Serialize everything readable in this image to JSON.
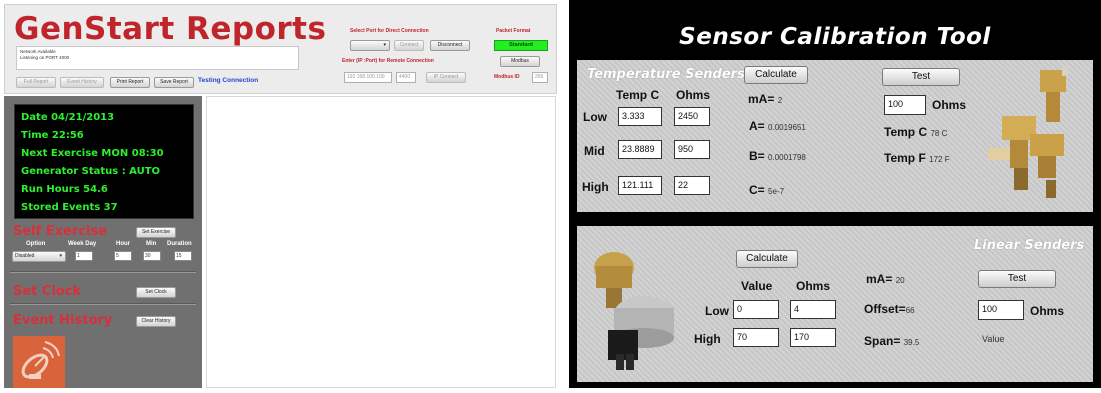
{
  "genstart": {
    "title": "GenStart Reports",
    "log_lines": [
      "Network Available",
      "Listening on PORT 4000"
    ],
    "buttons": {
      "full_report": "Full Report",
      "event_history": "Event History",
      "print_report": "Print Report",
      "save_report": "Save Report",
      "connect": "Connect",
      "disconnect": "Disconnect",
      "ip_connect": "IP Connect",
      "modbus": "Modbus"
    },
    "testing_connection": "Testing Connection",
    "select_port_label": "Select Port for Direct Connection",
    "enter_ip_label": "Enter (IP :Port) for Remote Connection",
    "ip_value": "192.168.100.100",
    "port_value": "4400",
    "packet_format_label": "Packet Format",
    "packet_format_value": "Standard",
    "modbus_id_label": "Modbus ID",
    "modbus_id_value": "255",
    "status": {
      "date": "Date 04/21/2013",
      "time": "Time 22:56",
      "next_exercise": "Next Exercise MON 08:30",
      "generator_status": "Generator Status : AUTO",
      "run_hours": "Run Hours 54.6",
      "stored_events": "Stored Events 37"
    },
    "self_exercise": {
      "title": "Self Exercise",
      "button": "Set Exercise",
      "headers": [
        "Option",
        "Week Day",
        "Hour",
        "Min",
        "Duration"
      ],
      "option_value": "Disabled",
      "week_day_value": "1",
      "hour_value": "5",
      "min_value": "30",
      "duration_value": "15"
    },
    "set_clock": {
      "title": "Set Clock",
      "button": "Set Clock"
    },
    "event_history": {
      "title": "Event History",
      "button": "Clear History"
    },
    "colors": {
      "accent": "#c0252b",
      "status_text": "#2ef02e",
      "packet_standard": "#22ee22",
      "link": "#2244cc"
    }
  },
  "sensor": {
    "title": "Sensor Calibration Tool",
    "temperature": {
      "title": "Temperature Senders",
      "calculate_button": "Calculate",
      "test_button": "Test",
      "col_temp": "Temp C",
      "col_ohms": "Ohms",
      "rows": [
        {
          "label": "Low",
          "temp": "3.333",
          "ohms": "2450"
        },
        {
          "label": "Mid",
          "temp": "23.8889",
          "ohms": "950"
        },
        {
          "label": "High",
          "temp": "121.111",
          "ohms": "22"
        }
      ],
      "ma_label": "mA=",
      "ma_value": "2",
      "a_label": "A=",
      "a_value": "0.0019651",
      "b_label": "B=",
      "b_value": "0.0001798",
      "c_label": "C=",
      "c_value": "5e-7",
      "test_input": "100",
      "test_unit": "Ohms",
      "temp_c_label": "Temp C",
      "temp_c_value": "78 C",
      "temp_f_label": "Temp F",
      "temp_f_value": "172 F"
    },
    "linear": {
      "title": "Linear Senders",
      "calculate_button": "Calculate",
      "test_button": "Test",
      "col_value": "Value",
      "col_ohms": "Ohms",
      "rows": [
        {
          "label": "Low",
          "value": "0",
          "ohms": "4"
        },
        {
          "label": "High",
          "value": "70",
          "ohms": "170"
        }
      ],
      "ma_label": "mA=",
      "ma_value": "20",
      "offset_label": "Offset=",
      "offset_value": "66",
      "span_label": "Span=",
      "span_value": "39.5",
      "test_input": "100",
      "test_unit": "Ohms",
      "result_label": "Value"
    }
  }
}
